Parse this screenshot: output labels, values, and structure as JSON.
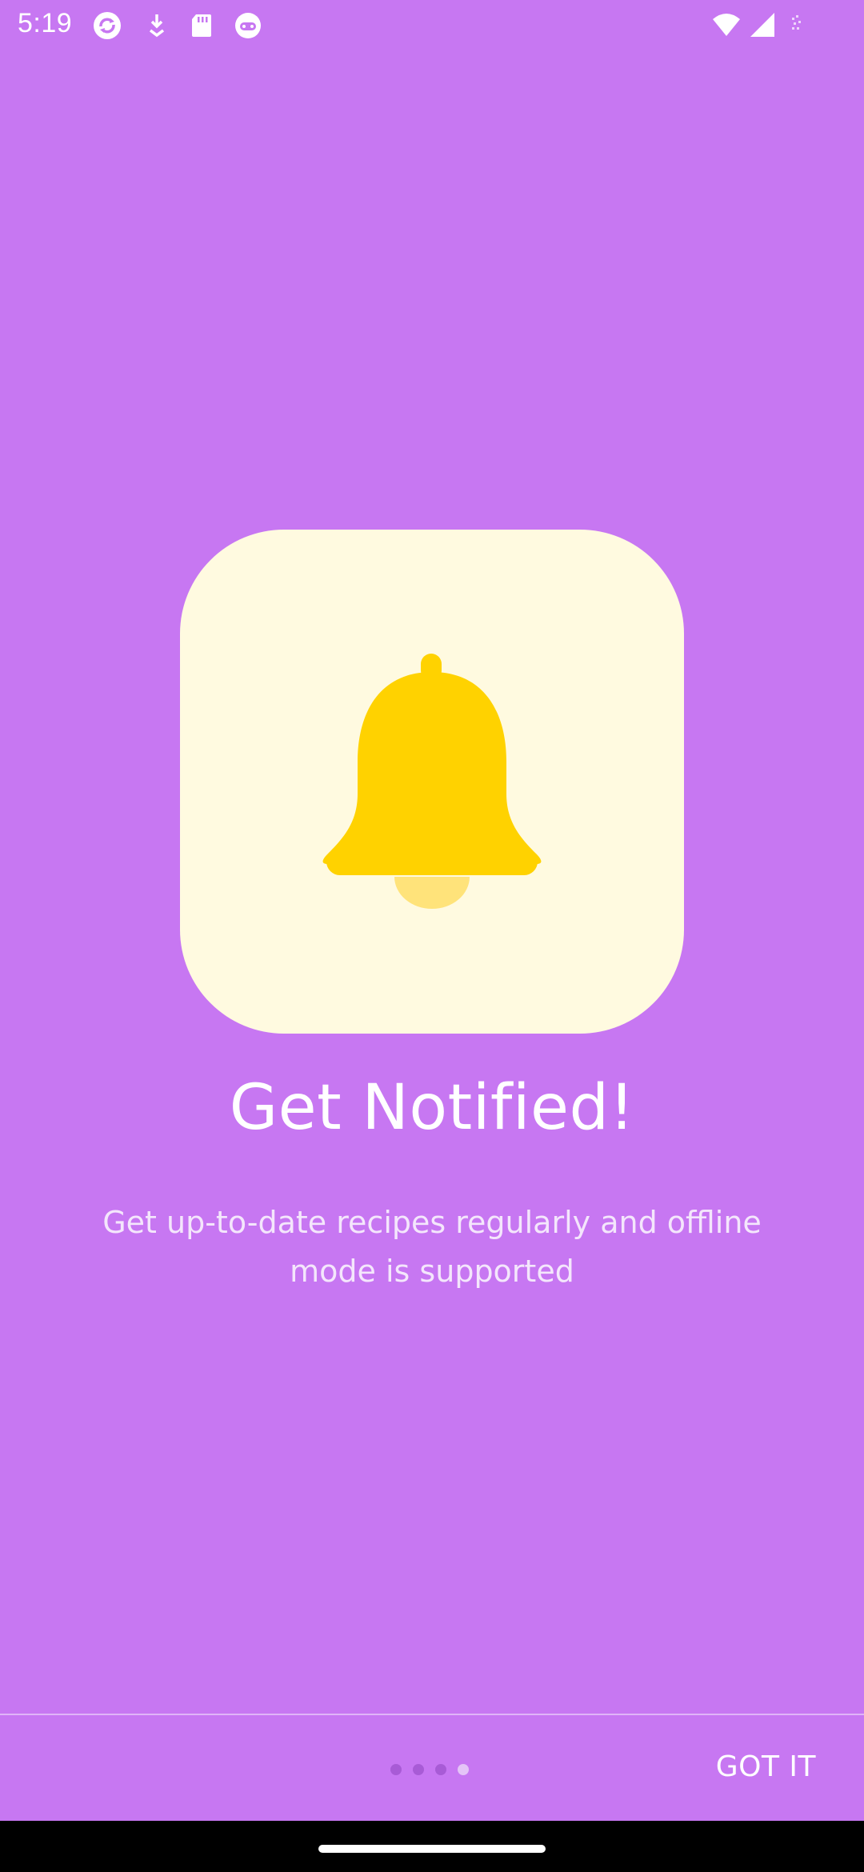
{
  "status_bar": {
    "time": "5:19",
    "icons": [
      "sync-icon",
      "download-icon",
      "sd-card-icon",
      "android-face-icon",
      "wifi-icon",
      "signal-icon",
      "battery-icon"
    ]
  },
  "onboarding": {
    "title": "Get Notified!",
    "description": "Get up-to-date recipes regularly and offline mode is supported",
    "illustration": "bell-icon",
    "page_count": 4,
    "active_page": 4
  },
  "footer": {
    "action_label": "GOT IT"
  },
  "colors": {
    "background": "#c777f2",
    "card": "#fffae0",
    "bell": "#ffd200",
    "bell_clapper": "#ffe37a"
  }
}
